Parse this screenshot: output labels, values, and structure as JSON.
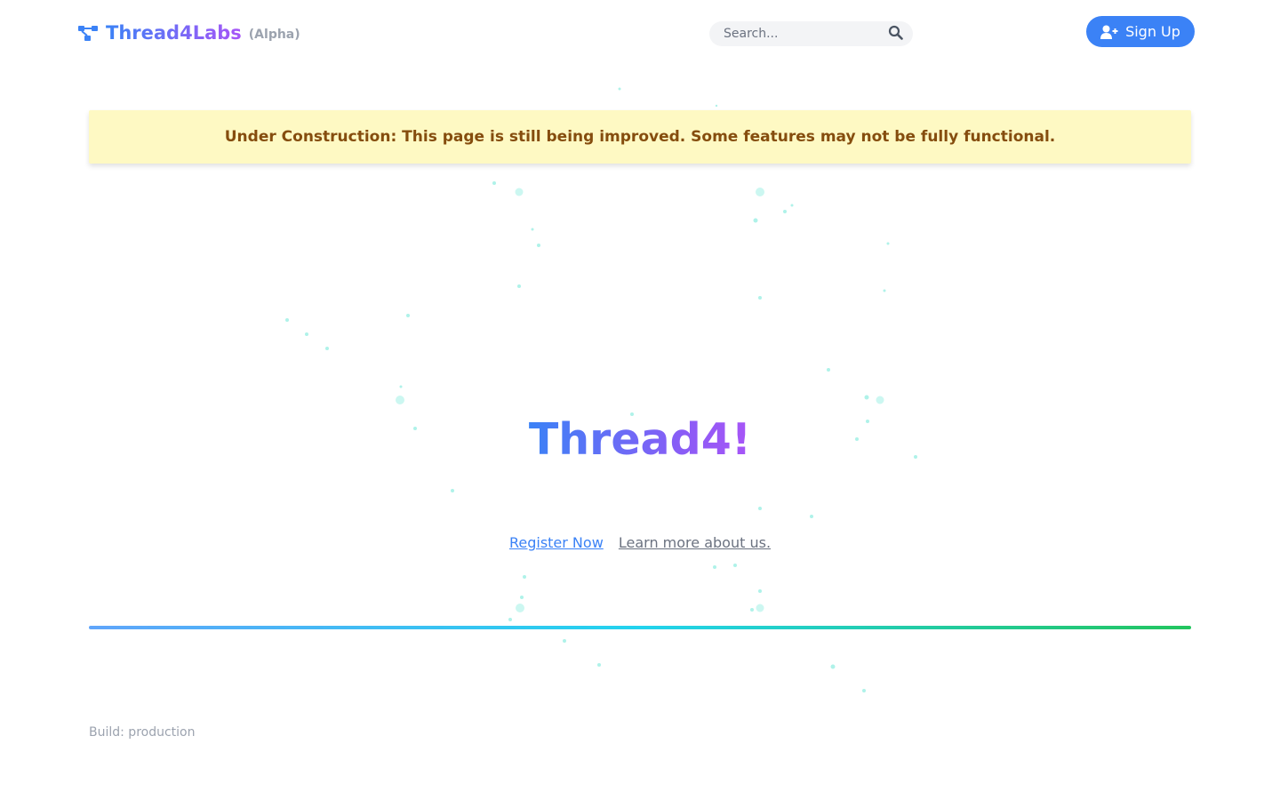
{
  "header": {
    "brand_name": "Thread4Labs",
    "brand_tag": "(Alpha)",
    "brand_icon": "network-icon",
    "search_placeholder": "Search...",
    "search_icon": "search-icon",
    "signup_label": "Sign Up",
    "signup_icon": "user-plus-icon"
  },
  "banner": {
    "text": "Under Construction: This page is still being improved. Some features may not be fully functional."
  },
  "hero": {
    "title": "Thread4!",
    "register_label": "Register Now",
    "about_label": "Learn more about us."
  },
  "footer": {
    "build": "Build: production"
  },
  "colors": {
    "primary": "#3b82f6",
    "accent": "#a855f7",
    "banner_bg": "#fef9c3",
    "banner_text": "#854d0e",
    "particle": "#6ee7d7"
  }
}
